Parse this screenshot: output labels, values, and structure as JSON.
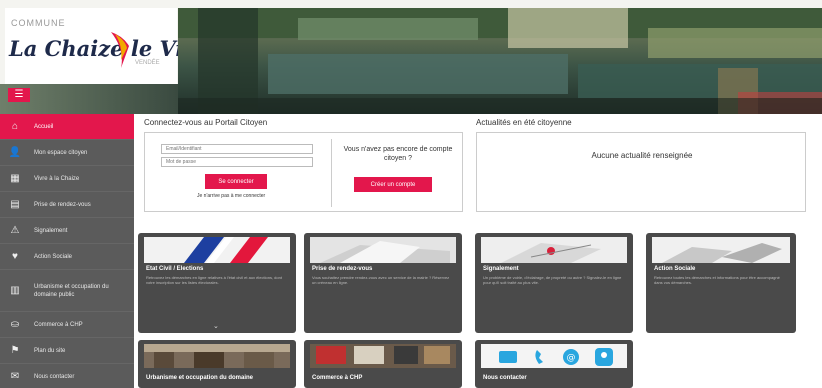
{
  "header": {
    "commune_label": "COMMUNE",
    "logo_name": "La Chaize le Vicomte",
    "logo_sub": "VENDÉE",
    "menu_icon": "hamburger-icon"
  },
  "sidebar": {
    "items": [
      {
        "label": "Accueil",
        "icon": "home-icon"
      },
      {
        "label": "Mon espace citoyen",
        "icon": "user-icon"
      },
      {
        "label": "Vivre à la Chaize",
        "icon": "building-icon"
      },
      {
        "label": "Prise de rendez-vous",
        "icon": "calendar-icon"
      },
      {
        "label": "Signalement",
        "icon": "warning-icon"
      },
      {
        "label": "Action Sociale",
        "icon": "heart-icon"
      },
      {
        "label": "Urbanisme et occupation du domaine public",
        "icon": "city-icon"
      },
      {
        "label": "Commerce à CHP",
        "icon": "shop-icon"
      },
      {
        "label": "Plan du site",
        "icon": "sitemap-icon"
      },
      {
        "label": "Nous contacter",
        "icon": "mail-icon"
      }
    ]
  },
  "login": {
    "section_title": "Connectez-vous au Portail Citoyen",
    "email_placeholder": "Email/Identifiant",
    "password_placeholder": "Mot de passe",
    "submit_label": "Se connecter",
    "forgot_link": "Je n'arrive pas à me connecter",
    "no_account_question": "Vous n'avez pas encore de compte citoyen ?",
    "create_account_label": "Créer un compte"
  },
  "news": {
    "section_title": "Actualités en été citoyenne",
    "empty_text": "Aucune actualité renseignée"
  },
  "tiles": [
    {
      "title": "Etat Civil / Elections",
      "text": "Retrouvez les démarches en ligne relatives à l'état civil et aux élections, dont votre inscription sur les listes électorales."
    },
    {
      "title": "Prise de rendez-vous",
      "text": "Vous souhaitez prendre rendez-vous avec un service de la mairie ? Réservez un créneau en ligne."
    },
    {
      "title": "Signalement",
      "text": "Un problème de voirie, d'éclairage, de propreté ou autre ? Signalez-le en ligne pour qu'il soit traité au plus vite."
    },
    {
      "title": "Action Sociale",
      "text": "Retrouvez toutes les démarches et informations pour être accompagné dans vos démarches."
    },
    {
      "title": "Urbanisme et occupation du domaine",
      "text": ""
    },
    {
      "title": "Commerce à CHP",
      "text": ""
    },
    {
      "title": "Nous contacter",
      "text": ""
    }
  ],
  "colors": {
    "accent": "#e3174c",
    "sidebar_bg": "#5b5b5b",
    "tile_bg": "#4a4a4a"
  }
}
